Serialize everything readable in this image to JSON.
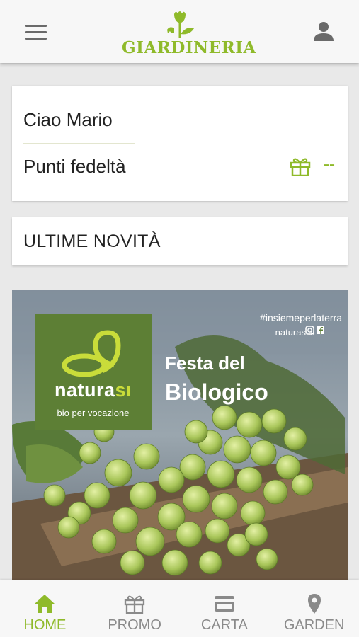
{
  "header": {
    "logo_text": "GIARDINERIA",
    "menu_icon": "hamburger-menu-icon",
    "profile_icon": "user-icon"
  },
  "greeting_card": {
    "greeting": "Ciao Mario",
    "points_label": "Punti fedeltà",
    "points_value": "--",
    "points_icon": "gift-icon"
  },
  "news": {
    "title": "ULTIME NOVITÀ"
  },
  "banner": {
    "hashtag": "#insiemeperlaterra",
    "website": "naturasi.it",
    "brand_prefix": "natura",
    "brand_suffix": "sı",
    "brand_tagline": "bio per vocazione",
    "headline_line1": "Festa del",
    "headline_line2": "Biologico"
  },
  "bottom_nav": {
    "items": [
      {
        "label": "HOME",
        "icon": "home-icon",
        "active": true
      },
      {
        "label": "PROMO",
        "icon": "gift-icon",
        "active": false
      },
      {
        "label": "CARTA",
        "icon": "card-icon",
        "active": false
      },
      {
        "label": "GARDEN",
        "icon": "location-pin-icon",
        "active": false
      }
    ]
  },
  "colors": {
    "accent": "#8fba2a",
    "brand_green": "#5d7f35",
    "inactive": "#8a8a8a"
  }
}
